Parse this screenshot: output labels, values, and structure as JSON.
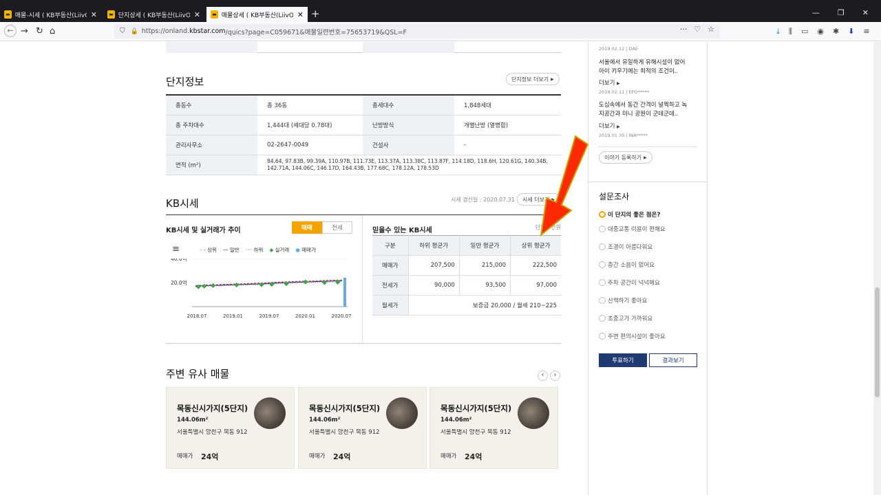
{
  "browser": {
    "tabs": [
      {
        "title": "매물-시세 ( KB부동산(LiivON) |"
      },
      {
        "title": "단지상세 ( KB부동산(LiivON) |"
      },
      {
        "title": "매물상세 ( KB부동산(LiivON) |"
      }
    ],
    "url_prefix": "https://onland.",
    "url_domain": "kbstar.com",
    "url_rest": "/quics?page=C059671&매물일련번호=75653719&QSL=F",
    "url_tools": "···"
  },
  "complex_info": {
    "title": "단지정보",
    "more_label": "단지정보 더보기",
    "rows": [
      {
        "h1": "총동수",
        "v1": "총 36동",
        "h2": "총세대수",
        "v2": "1,848세대"
      },
      {
        "h1": "총 주차대수",
        "v1": "1,444대 (세대당 0.78대)",
        "h2": "난방방식",
        "v2": "개별난방 (열병합)"
      },
      {
        "h1": "관리사무소",
        "v1": "02-2647-0049",
        "h2": "건설사",
        "v2": "-"
      }
    ],
    "area_label": "면적 (m²)",
    "area_value": "84.64, 97.83B, 99.39A, 110.97B, 111.73E, 113.37A, 113.38C, 113.87F, 114.18D, 118.6H, 120.61G, 140.34B, 142.71A, 144.06C, 146.17D, 164.43B, 177.68C, 178.12A, 178.53D"
  },
  "kb_price": {
    "title": "KB시세",
    "updated": "시세 갱신일 : 2020.07.31",
    "more_label": "시세 더보기",
    "chart_title": "KB시세 및 실거래가 추이",
    "toggle_on": "매매",
    "toggle_off": "전세",
    "menu_icon": "≡",
    "legend": {
      "upper": "상위",
      "normal": "일반",
      "lower": "하위",
      "actual": "실거래",
      "listing": "매매가"
    },
    "table_title": "믿을수 있는 KB시세",
    "unit": "단위 : 만원",
    "headers": [
      "구분",
      "하위 평균가",
      "일반 평균가",
      "상위 평균가"
    ],
    "rows": [
      {
        "label": "매매가",
        "values": [
          "207,500",
          "215,000",
          "222,500"
        ]
      },
      {
        "label": "전세가",
        "values": [
          "90,000",
          "93,500",
          "97,000"
        ]
      }
    ],
    "monthly_label": "월세가",
    "monthly_value": "보증금 20,000 / 월세 210~225"
  },
  "chart_data": {
    "type": "line",
    "title": "KB시세 및 실거래가 추이",
    "x_ticks": [
      "2018.07",
      "2019.01",
      "2019.07",
      "2020.01",
      "2020.07"
    ],
    "y_ticks": [
      "40.0억",
      "20.0억"
    ],
    "ylim": [
      0,
      40
    ],
    "series": [
      {
        "name": "상위",
        "values": [
          17.6,
          17.9,
          18.2,
          18.3,
          18.6,
          18.8,
          19.0,
          19.2,
          19.5,
          19.8,
          20.2,
          20.5,
          20.7,
          21.0,
          21.2,
          21.4,
          21.6,
          21.8,
          22.0,
          22.25
        ]
      },
      {
        "name": "일반",
        "values": [
          17.0,
          17.3,
          17.6,
          17.7,
          18.0,
          18.2,
          18.4,
          18.6,
          18.8,
          19.1,
          19.5,
          19.8,
          20.0,
          20.3,
          20.5,
          20.7,
          20.9,
          21.1,
          21.3,
          21.5
        ]
      },
      {
        "name": "하위",
        "values": [
          16.4,
          16.7,
          17.0,
          17.1,
          17.4,
          17.6,
          17.8,
          18.0,
          18.2,
          18.4,
          18.8,
          19.1,
          19.3,
          19.6,
          19.8,
          20.0,
          20.2,
          20.4,
          20.55,
          20.75
        ]
      }
    ],
    "actual_trades": [
      {
        "x": 0.02,
        "y": 16.5
      },
      {
        "x": 0.06,
        "y": 17.0
      },
      {
        "x": 0.12,
        "y": 17.5
      },
      {
        "x": 0.28,
        "y": 18.0
      },
      {
        "x": 0.45,
        "y": 18.2
      },
      {
        "x": 0.52,
        "y": 18.5
      },
      {
        "x": 0.62,
        "y": 19.0
      },
      {
        "x": 0.75,
        "y": 20.5
      },
      {
        "x": 0.88,
        "y": 20.0
      },
      {
        "x": 0.97,
        "y": 20.3
      }
    ],
    "listing_bar": {
      "x": 1.0,
      "y": 24
    }
  },
  "similar": {
    "title": "주변 유사 매물",
    "prev": "‹",
    "next": "›",
    "cards": [
      {
        "name": "목동신시가지(5단지)",
        "area": "144.06m²",
        "address": "서울특별시 양천구 목동 912",
        "price_label": "매매가",
        "price": "24억"
      },
      {
        "name": "목동신시가지(5단지)",
        "area": "144.06m²",
        "address": "서울특별시 양천구 목동 912",
        "price_label": "매매가",
        "price": "24억"
      },
      {
        "name": "목동신시가지(5단지)",
        "area": "144.06m²",
        "address": "서울특별시 양천구 목동 912",
        "price_label": "매매가",
        "price": "24억"
      }
    ]
  },
  "sidebar": {
    "top_meta": "2019.02.12 | DAE",
    "stories": [
      {
        "line1": "서울에서 유일하게 유해시설이 없어",
        "line2": "아이 키우기에는 최적의 조건이..",
        "more": "더보기",
        "meta": "2019.02.11  |  EPO*****"
      },
      {
        "line1": "도심속에서 동간 간격이 널찍하고 녹",
        "line2": "지공간과 미니 공원이 군데군데..",
        "more": "더보기",
        "meta": "2019.01.30  |  INA*****"
      }
    ],
    "register_label": "이야기 등록하기",
    "survey_title": "설문조사",
    "survey_question": "이 단지의 좋은 점은?",
    "survey_options": [
      "대중교통 이용이 편해요",
      "조경이 아름다워요",
      "층간 소음이 없어요",
      "주차 공간이 넉넉해요",
      "산책하기 좋아요",
      "초중고가 가까워요",
      "주변 편의시설이 좋아요"
    ],
    "vote_label": "투표하기",
    "result_label": "결과보기"
  },
  "colors": {
    "accent": "#f5a300",
    "vote_btn": "#1f3a6e",
    "arrow": "#ff2a00"
  }
}
